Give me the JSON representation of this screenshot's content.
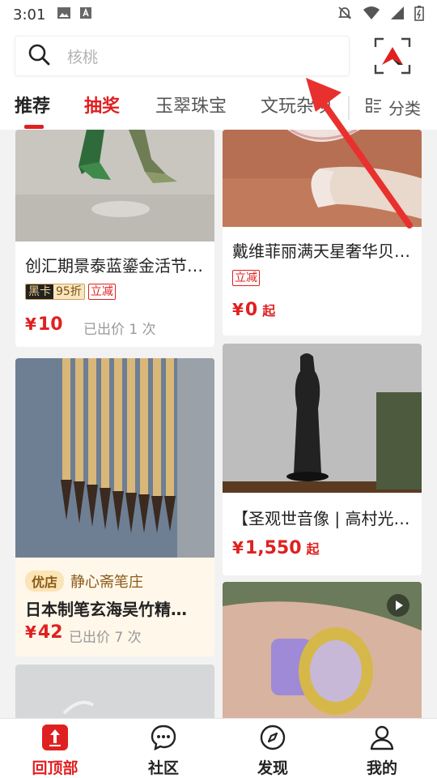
{
  "status_bar": {
    "time": "3:01"
  },
  "search": {
    "placeholder": "核桃"
  },
  "tabs": [
    {
      "label": "推荐"
    },
    {
      "label": "抽奖"
    },
    {
      "label": "玉翠珠宝"
    },
    {
      "label": "文玩杂项"
    }
  ],
  "category_button": {
    "label": "分类"
  },
  "cards": [
    {
      "title": "创汇期景泰蓝鎏金活节…",
      "heika_label": "黑卡",
      "discount": "95折",
      "tag": "立减",
      "price_symbol": "¥",
      "price": "10",
      "sold": "已出价 1 次"
    },
    {
      "title": "戴维菲丽满天星奢华贝…",
      "tag": "立减",
      "price_symbol": "¥",
      "price": "0",
      "price_suffix": "起"
    },
    {
      "shop_badge": "优店",
      "shop_name": "静心斋笔庄",
      "title": "日本制笔玄海吴竹精…",
      "price_symbol": "¥",
      "price": "42",
      "sold": "已出价 7 次"
    },
    {
      "title": "【圣观世音像 | 高村光…",
      "price_symbol": "¥",
      "price": "1,550",
      "price_suffix": "起"
    }
  ],
  "bottom_nav": [
    {
      "label": "回顶部",
      "icon": "back-to-top-icon",
      "active": true
    },
    {
      "label": "社区",
      "icon": "community-icon"
    },
    {
      "label": "发现",
      "icon": "compass-icon"
    },
    {
      "label": "我的",
      "icon": "user-icon"
    }
  ],
  "colors": {
    "accent": "#e02020",
    "background": "#f2f2f2"
  }
}
